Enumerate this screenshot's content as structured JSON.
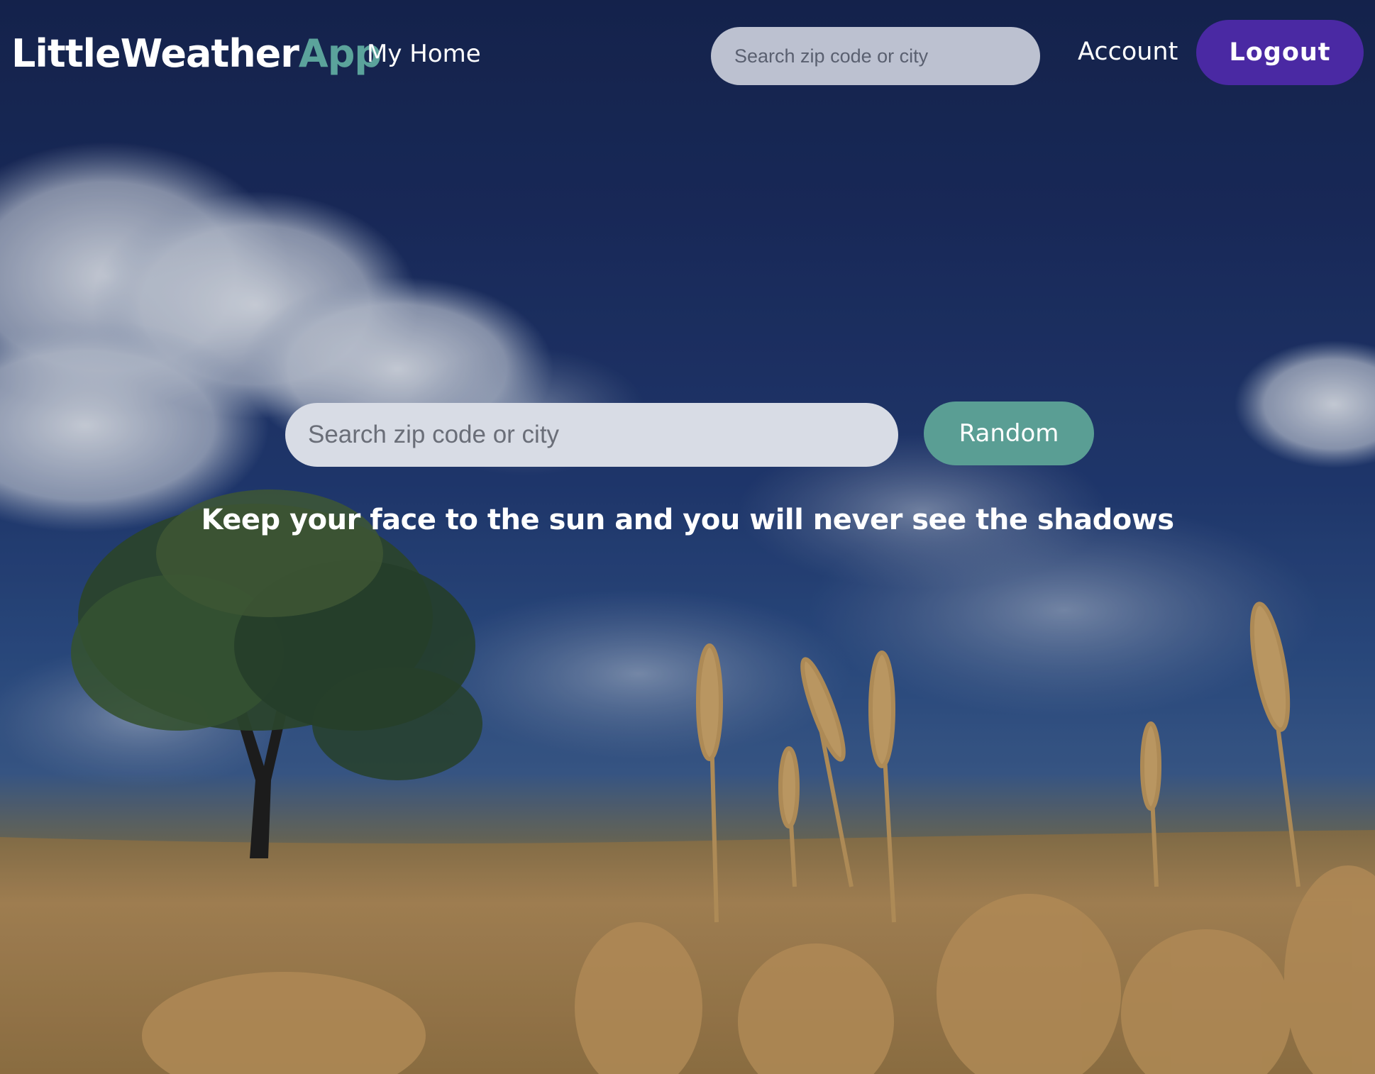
{
  "header": {
    "logo_main": "LittleWeather",
    "logo_accent": "App",
    "nav_home": "My Home",
    "search_placeholder": "Search zip code or city",
    "nav_account": "Account",
    "logout_label": "Logout"
  },
  "hero": {
    "search_placeholder": "Search zip code or city",
    "random_label": "Random",
    "tagline": "Keep your face to the sun and you will never see the shadows"
  },
  "colors": {
    "logo_accent": "#5ba39b",
    "logout_button": "#4a29a3",
    "random_button": "#5a9e94",
    "sky": "#1b2b5d",
    "wheat": "#b89058"
  },
  "background": {
    "scene": [
      "sky",
      "clouds",
      "tree",
      "wheat-field"
    ]
  }
}
